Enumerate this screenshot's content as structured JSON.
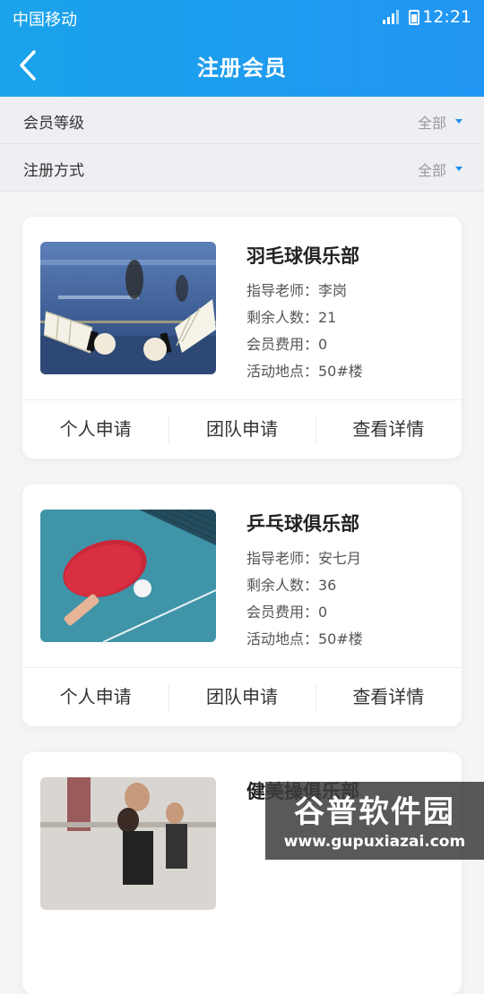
{
  "status_bar": {
    "carrier": "中国移动",
    "time": "12:21"
  },
  "header": {
    "title": "注册会员",
    "back_icon": "chevron-left-icon"
  },
  "filters": [
    {
      "label": "会员等级",
      "value": "全部"
    },
    {
      "label": "注册方式",
      "value": "全部"
    }
  ],
  "clubs": [
    {
      "name": "羽毛球俱乐部",
      "image": "badminton-shuttlecocks-photo",
      "info": [
        "指导老师：李岗",
        "剩余人数：21",
        "会员费用：0",
        "活动地点：50#楼"
      ],
      "actions": [
        "个人申请",
        "团队申请",
        "查看详情"
      ]
    },
    {
      "name": "乒乓球俱乐部",
      "image": "table-tennis-paddle-photo",
      "info": [
        "指导老师：安七月",
        "剩余人数：36",
        "会员费用：0",
        "活动地点：50#楼"
      ],
      "actions": [
        "个人申请",
        "团队申请",
        "查看详情"
      ]
    },
    {
      "name": "健美操俱乐部",
      "image": "ballet-dancers-photo"
    }
  ],
  "watermark": {
    "title": "谷普软件园",
    "url": "www.gupuxiazai.com"
  },
  "colors": {
    "header_start": "#1aa3ea",
    "header_end": "#2196f3",
    "accent": "#1f8ef1"
  }
}
